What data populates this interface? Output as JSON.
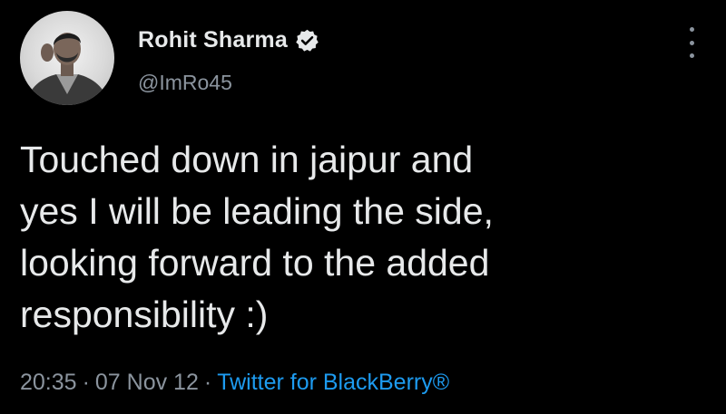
{
  "author": {
    "display_name": "Rohit Sharma",
    "handle": "@ImRo45",
    "verified": true
  },
  "tweet": {
    "lines": [
      "Touched down in jaipur and",
      "yes I will be leading the side,",
      "looking forward to the added",
      "responsibility :)"
    ],
    "time": "20:35",
    "date": "07 Nov 12",
    "separator": "·",
    "source": "Twitter for BlackBerry®"
  },
  "icons": {
    "verified": "verified-badge-icon",
    "more": "more-options-icon"
  },
  "colors": {
    "background": "#000000",
    "text": "#e7e9ea",
    "muted": "#8b949e",
    "link": "#1d9bf0"
  }
}
